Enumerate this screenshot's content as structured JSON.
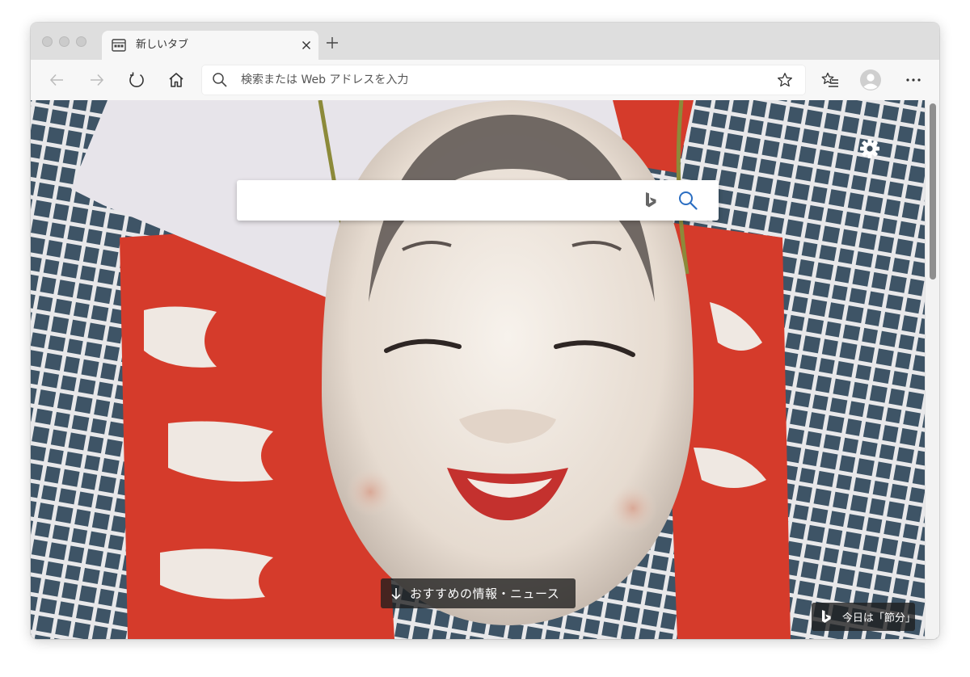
{
  "browser": {
    "tab": {
      "title": "新しいタブ",
      "icon": "new-tab-page-icon"
    },
    "toolbar": {
      "address_placeholder": "検索または Web アドレスを入力",
      "address_value": ""
    }
  },
  "page": {
    "search": {
      "placeholder": ""
    },
    "news_button_label": "おすすめの情報・ニュース",
    "image_of_day_label": "今日は「節分」"
  },
  "colors": {
    "accent_search": "#2b6ec2",
    "bing_gray": "#666666",
    "tabstrip": "#dedede",
    "toolbar": "#f7f7f7"
  }
}
